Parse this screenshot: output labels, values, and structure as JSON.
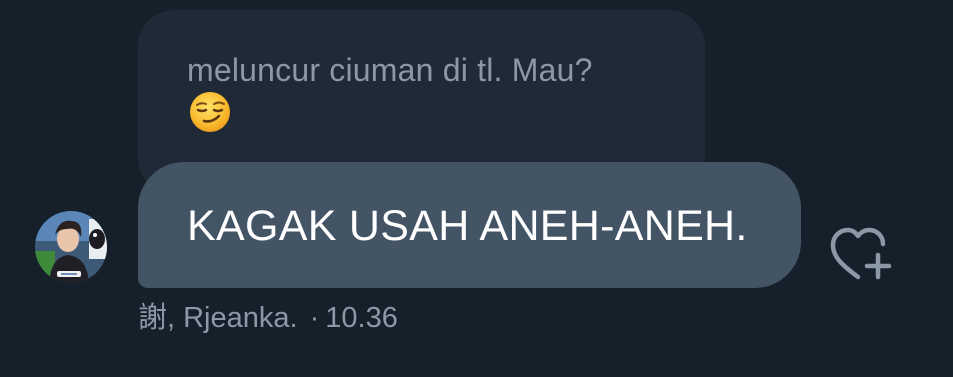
{
  "quoted_message": {
    "text": "meluncur ciuman di tl. Mau?",
    "emoji": "smirking-face"
  },
  "reply_message": {
    "text": "KAGAK USAH ANEH-ANEH."
  },
  "sender": {
    "name": "謝, Rjeanka.",
    "timestamp": "10.36",
    "separator": "·"
  },
  "actions": {
    "react_icon": "heart-plus-icon"
  },
  "colors": {
    "background": "#15202b",
    "quoted_bubble": "#202a36",
    "reply_bubble": "#435464",
    "muted_text": "#8b98a5",
    "reply_text": "#ffffff"
  }
}
